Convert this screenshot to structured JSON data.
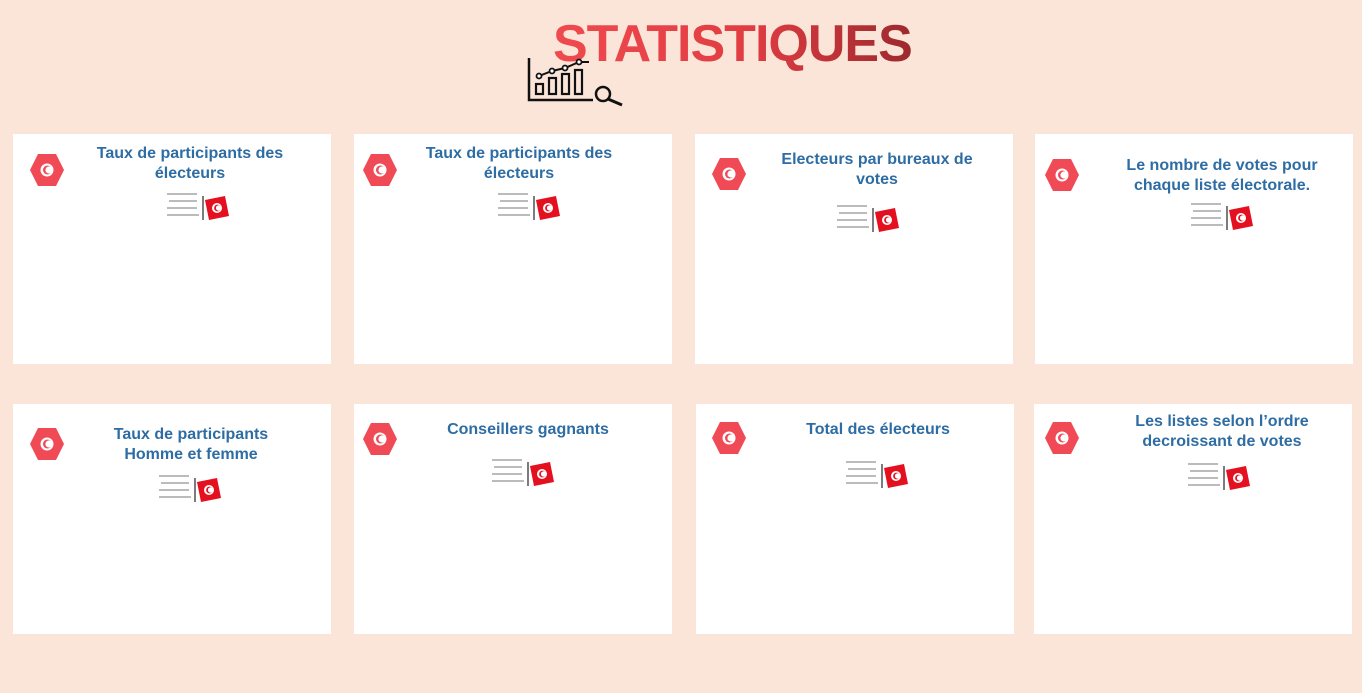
{
  "page": {
    "title": "STATISTIQUES"
  },
  "colors": {
    "background": "#fbe5d9",
    "title_gradient": [
      "#f04a4f",
      "#9c2a2e"
    ],
    "card_title": "#2e6da4",
    "badge": "#ef4a55",
    "flag_red": "#e4101f"
  },
  "cards": [
    {
      "title": "Taux de participants des électeurs",
      "icon": "tunisia-flag-badge-icon"
    },
    {
      "title": "Taux de participants des électeurs",
      "icon": "tunisia-flag-badge-icon"
    },
    {
      "title": "Electeurs par bureaux de votes",
      "icon": "tunisia-flag-badge-icon"
    },
    {
      "title": "Le nombre de votes pour chaque liste électorale.",
      "icon": "tunisia-flag-badge-icon"
    },
    {
      "title": "Taux de participants Homme et femme",
      "icon": "tunisia-flag-badge-icon"
    },
    {
      "title": "Conseillers gagnants",
      "icon": "tunisia-flag-badge-icon"
    },
    {
      "title": "Total des électeurs",
      "icon": "tunisia-flag-badge-icon"
    },
    {
      "title": "Les listes selon l’ordre decroissant de votes",
      "icon": "tunisia-flag-badge-icon"
    }
  ]
}
